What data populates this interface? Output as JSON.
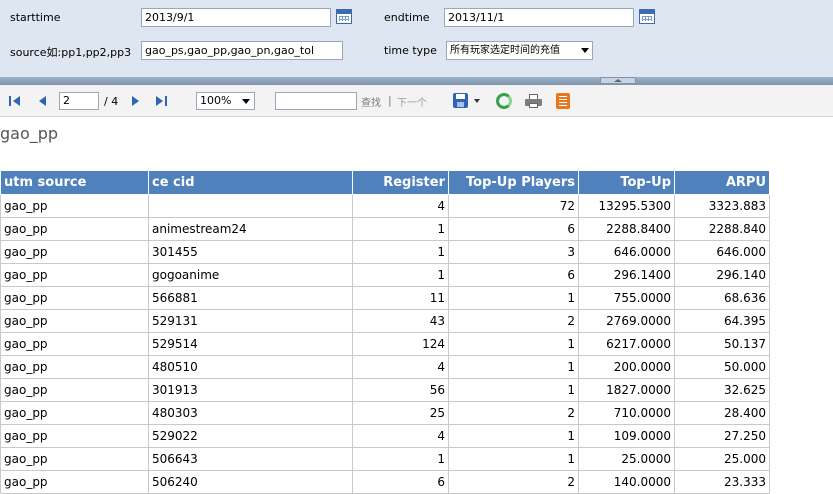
{
  "params": {
    "starttime_label": "starttime",
    "starttime_value": "2013/9/1",
    "endtime_label": "endtime",
    "endtime_value": "2013/11/1",
    "source_label": "source如:pp1,pp2,pp3",
    "source_value": "gao_ps,gao_pp,gao_pn,gao_tol",
    "timetype_label": "time type",
    "timetype_value": "所有玩家选定时间的充值"
  },
  "toolbar": {
    "page_current": "2",
    "page_total": "/ 4",
    "zoom": "100%",
    "find_label": "查找",
    "separator": "|",
    "next_label": "下一个"
  },
  "report": {
    "title": "gao_pp",
    "columns": [
      "utm source",
      "ce cid",
      "Register",
      "Top-Up Players",
      "Top-Up",
      "ARPU"
    ],
    "rows": [
      [
        "gao_pp",
        "",
        "4",
        "72",
        "13295.5300",
        "3323.883"
      ],
      [
        "gao_pp",
        "animestream24",
        "1",
        "6",
        "2288.8400",
        "2288.840"
      ],
      [
        "gao_pp",
        "301455",
        "1",
        "3",
        "646.0000",
        "646.000"
      ],
      [
        "gao_pp",
        "gogoanime",
        "1",
        "6",
        "296.1400",
        "296.140"
      ],
      [
        "gao_pp",
        "566881",
        "11",
        "1",
        "755.0000",
        "68.636"
      ],
      [
        "gao_pp",
        "529131",
        "43",
        "2",
        "2769.0000",
        "64.395"
      ],
      [
        "gao_pp",
        "529514",
        "124",
        "1",
        "6217.0000",
        "50.137"
      ],
      [
        "gao_pp",
        "480510",
        "4",
        "1",
        "200.0000",
        "50.000"
      ],
      [
        "gao_pp",
        "301913",
        "56",
        "1",
        "1827.0000",
        "32.625"
      ],
      [
        "gao_pp",
        "480303",
        "25",
        "2",
        "710.0000",
        "28.400"
      ],
      [
        "gao_pp",
        "529022",
        "4",
        "1",
        "109.0000",
        "27.250"
      ],
      [
        "gao_pp",
        "506643",
        "1",
        "1",
        "25.0000",
        "25.000"
      ],
      [
        "gao_pp",
        "506240",
        "6",
        "2",
        "140.0000",
        "23.333"
      ]
    ]
  }
}
